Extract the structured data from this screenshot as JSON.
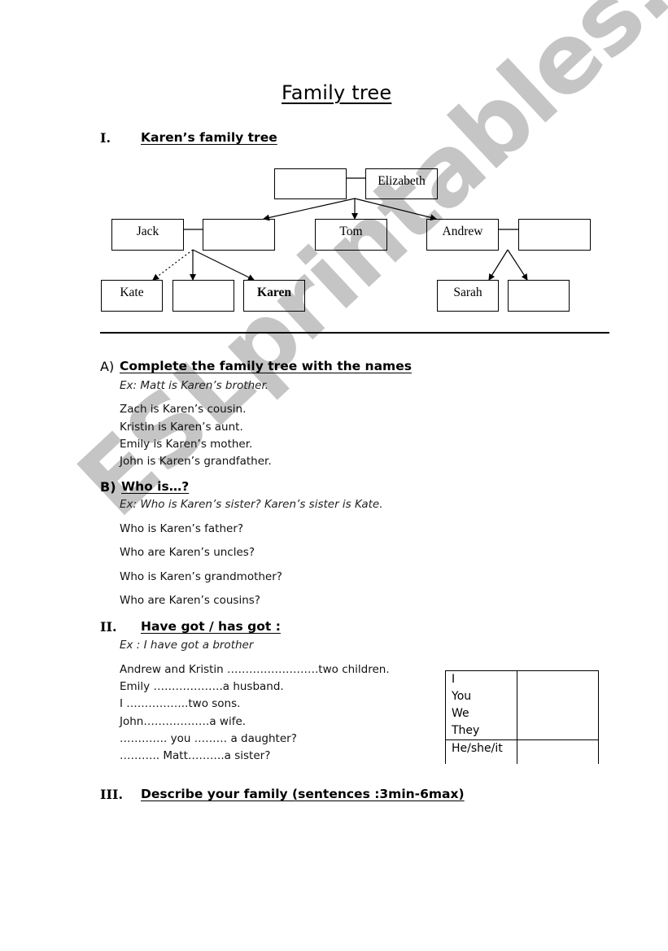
{
  "title": "Family tree",
  "section1": {
    "numeral": "I.",
    "heading": "Karen’s family tree",
    "tree": {
      "grandparents": [
        {
          "name": ""
        },
        {
          "name": "Elizabeth"
        }
      ],
      "parents_row": [
        {
          "name": "Jack"
        },
        {
          "name": ""
        },
        {
          "name": "Tom"
        },
        {
          "name": "Andrew"
        },
        {
          "name": ""
        }
      ],
      "children_row": [
        {
          "name": "Kate"
        },
        {
          "name": ""
        },
        {
          "name": "Karen",
          "bold": true
        },
        {
          "name": "Sarah"
        },
        {
          "name": ""
        }
      ]
    }
  },
  "partA": {
    "letter": "A)",
    "heading": "Complete the family tree with the names",
    "example": "Ex: Matt is Karen’s brother.",
    "lines": [
      "Zach is Karen’s cousin.",
      "Kristin is Karen’s aunt.",
      "Emily is Karen’s mother.",
      "John is Karen’s grandfather."
    ]
  },
  "partB": {
    "letter": "B)",
    "heading": "Who is…?",
    "example": "Ex: Who is Karen’s sister? Karen’s sister is Kate.",
    "questions": [
      "Who is Karen’s father?",
      "Who are Karen’s uncles?",
      "Who is Karen’s grandmother?",
      "Who are Karen’s cousins?"
    ]
  },
  "section2": {
    "numeral": "II.",
    "heading": "Have got / has got :",
    "example": "Ex : I have got a brother",
    "lines": [
      "Andrew and Kristin …………………….two children.",
      "Emily ……………….a husband.",
      "I ……………..two sons.",
      "John………………a wife.",
      "…………. you ……… a daughter?",
      "……….. Matt……….a sister?"
    ],
    "table": {
      "row1_pronouns": [
        "I",
        "You",
        "We",
        "They"
      ],
      "row2_pronouns": [
        "He/she/it"
      ],
      "row1_answer": "",
      "row2_answer": ""
    }
  },
  "section3": {
    "numeral": "III.",
    "heading": "Describe your family (sentences :3min-6max)"
  },
  "watermark": "ESLprintables.com"
}
